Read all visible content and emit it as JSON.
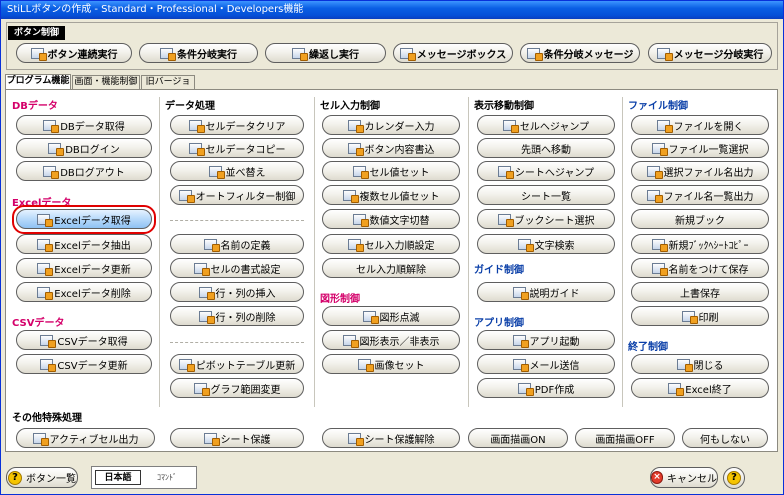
{
  "window": {
    "title": "StiLLボタンの作成 - Standard・Professional・Developers機能"
  },
  "control_group": {
    "tag": "ボタン制御",
    "buttons": [
      "ボタン連続実行",
      "条件分岐実行",
      "繰返し実行",
      "メッセージボックス",
      "条件分岐メッセージ",
      "メッセージ分岐実行"
    ]
  },
  "tabs": [
    "プログラム機能",
    "画面・機能制御",
    "旧バージョン"
  ],
  "sections": {
    "db": {
      "title": "DBデータ",
      "buttons": [
        "DBデータ取得",
        "DBログイン",
        "DBログアウト"
      ]
    },
    "excel": {
      "title": "Excelデータ",
      "buttons": [
        "Excelデータ取得",
        "Excelデータ抽出",
        "Excelデータ更新",
        "Excelデータ削除"
      ]
    },
    "csv": {
      "title": "CSVデータ",
      "buttons": [
        "CSVデータ取得",
        "CSVデータ更新"
      ]
    },
    "data": {
      "title": "データ処理",
      "buttons": [
        "セルデータクリア",
        "セルデータコピー",
        "並べ替え",
        "オートフィルター制御",
        "名前の定義",
        "セルの書式設定",
        "行・列の挿入",
        "行・列の削除",
        "ピボットテーブル更新",
        "グラフ範囲変更"
      ]
    },
    "cellin": {
      "title": "セル入力制御",
      "buttons": [
        "カレンダー入力",
        "ボタン内容書込",
        "セル値セット",
        "複数セル値セット",
        "数値文字切替",
        "セル入力順設定",
        "セル入力順解除"
      ]
    },
    "shape": {
      "title": "図形制御",
      "buttons": [
        "図形点滅",
        "図形表示／非表示",
        "画像セット"
      ]
    },
    "move": {
      "title": "表示移動制御",
      "buttons": [
        "セルへジャンプ",
        "先頭へ移動",
        "シートへジャンプ",
        "シート一覧",
        "ブックシート選択",
        "文字検索"
      ]
    },
    "guide": {
      "title": "ガイド制御",
      "buttons": [
        "説明ガイド"
      ]
    },
    "app": {
      "title": "アプリ制御",
      "buttons": [
        "アプリ起動",
        "メール送信",
        "PDF作成"
      ]
    },
    "file": {
      "title": "ファイル制御",
      "buttons": [
        "ファイルを開く",
        "ファイル一覧選択",
        "選択ファイル名出力",
        "ファイル名一覧出力",
        "新規ブック",
        "新規ﾌﾞｯｸﾍｼｰﾄｺﾋﾟｰ",
        "名前をつけて保存",
        "上書保存",
        "印刷"
      ]
    },
    "end": {
      "title": "終了制御",
      "buttons": [
        "閉じる",
        "Excel終了"
      ]
    },
    "other": {
      "title": "その他特殊処理",
      "buttons": [
        "アクティブセル出力",
        "シート保護",
        "シート保護解除",
        "画面描画ON",
        "画面描画OFF",
        "何もしない"
      ]
    }
  },
  "footer": {
    "list_button": "ボタン一覧",
    "lang_on": "日本語",
    "lang_off": "ｺﾏﾝﾄﾞ",
    "cancel_button": "キャンセル",
    "help_mark": "?",
    "cancel_mark": "×"
  },
  "colors": {
    "section_red": "#d4006a",
    "section_blue": "#0a3fa8",
    "selected_ring": "#e00000",
    "titlebar": "#0a5fe4"
  }
}
